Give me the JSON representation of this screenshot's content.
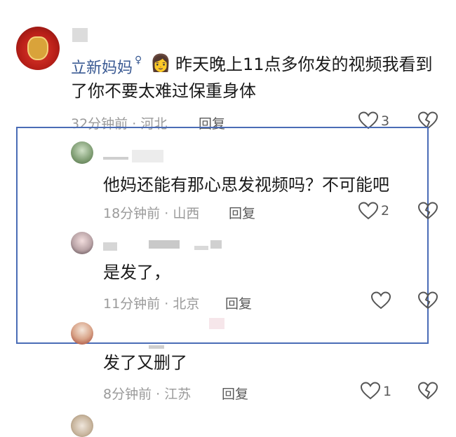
{
  "comments": [
    {
      "username": "立新妈妈",
      "emoji": "👩",
      "text_line1": "昨天晚上11点多你发的视频我看到",
      "text_line2": "了你不要太难过保重身体",
      "time": "32分钟前",
      "location": "河北",
      "reply_label": "回复",
      "likes": "3"
    },
    {
      "text": "他妈还能有那心思发视频吗？不可能吧",
      "time": "18分钟前",
      "location": "山西",
      "reply_label": "回复",
      "likes": "2"
    },
    {
      "text": "是发了，",
      "time": "11分钟前",
      "location": "北京",
      "reply_label": "回复",
      "likes": ""
    },
    {
      "text": "发了又删了",
      "time": "8分钟前",
      "location": "江苏",
      "reply_label": "回复",
      "likes": "1"
    }
  ],
  "colors": {
    "highlight_border": "#4a6cb6",
    "username": "#3a5a93",
    "meta_gray": "#9a9a9a"
  }
}
